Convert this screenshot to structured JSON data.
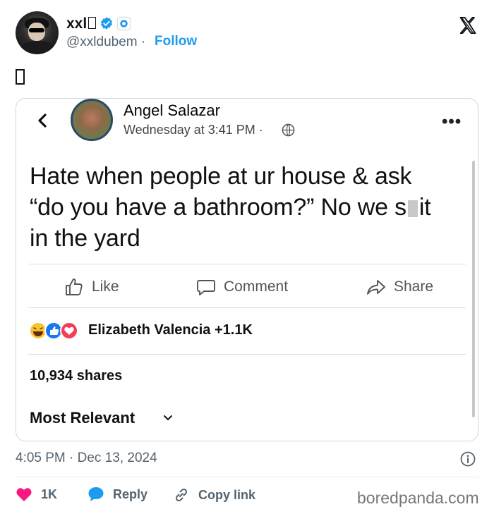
{
  "tweet": {
    "author_name": "xxl",
    "handle": "@xxldubem",
    "separator": "·",
    "follow_label": "Follow",
    "timestamp": "4:05 PM · Dec 13, 2024",
    "likes_count": "1K",
    "reply_label": "Reply",
    "copy_link_label": "Copy link"
  },
  "embedded_post": {
    "author": "Angel Salazar",
    "time": "Wednesday at 3:41 PM ·",
    "text_line1": "Hate when people at ur house & ask",
    "text_line2_before": "“do you have a bathroom?” No we s",
    "text_line2_after": "it",
    "text_line3": "in the yard",
    "actions": {
      "like": "Like",
      "comment": "Comment",
      "share": "Share"
    },
    "reactions_text": "Elizabeth Valencia +1.1K",
    "shares_text": "10,934 shares",
    "sort_label": "Most Relevant"
  },
  "watermark": "boredpanda.com",
  "colors": {
    "accent": "#1d9bf0",
    "like_heart": "#f91880",
    "reply_bubble": "#1d9bf0",
    "muted": "#536471"
  }
}
